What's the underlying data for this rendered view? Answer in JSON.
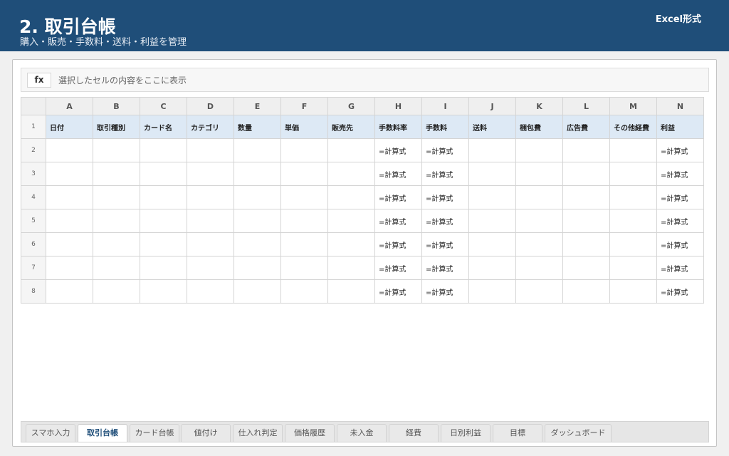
{
  "header": {
    "title": "2. 取引台帳",
    "subtitle": "購入・販売・手数料・送料・利益を管理",
    "format_label": "Excel形式"
  },
  "formula_bar": {
    "fx_label": "fx",
    "text": "選択したセルの内容をここに表示"
  },
  "sheet": {
    "columns": [
      "A",
      "B",
      "C",
      "D",
      "E",
      "F",
      "G",
      "H",
      "I",
      "J",
      "K",
      "L",
      "M",
      "N"
    ],
    "header_row_number": "1",
    "headers": [
      "日付",
      "取引種別",
      "カード名",
      "カテゴリ",
      "数量",
      "単価",
      "販売先",
      "手数料率",
      "手数料",
      "送料",
      "梱包費",
      "広告費",
      "その他経費",
      "利益"
    ],
    "rows": [
      {
        "num": "2",
        "cells": [
          "",
          "",
          "",
          "",
          "",
          "",
          "",
          "=計算式",
          "=計算式",
          "",
          "",
          "",
          "",
          "=計算式"
        ]
      },
      {
        "num": "3",
        "cells": [
          "",
          "",
          "",
          "",
          "",
          "",
          "",
          "=計算式",
          "=計算式",
          "",
          "",
          "",
          "",
          "=計算式"
        ]
      },
      {
        "num": "4",
        "cells": [
          "",
          "",
          "",
          "",
          "",
          "",
          "",
          "=計算式",
          "=計算式",
          "",
          "",
          "",
          "",
          "=計算式"
        ]
      },
      {
        "num": "5",
        "cells": [
          "",
          "",
          "",
          "",
          "",
          "",
          "",
          "=計算式",
          "=計算式",
          "",
          "",
          "",
          "",
          "=計算式"
        ]
      },
      {
        "num": "6",
        "cells": [
          "",
          "",
          "",
          "",
          "",
          "",
          "",
          "=計算式",
          "=計算式",
          "",
          "",
          "",
          "",
          "=計算式"
        ]
      },
      {
        "num": "7",
        "cells": [
          "",
          "",
          "",
          "",
          "",
          "",
          "",
          "=計算式",
          "=計算式",
          "",
          "",
          "",
          "",
          "=計算式"
        ]
      },
      {
        "num": "8",
        "cells": [
          "",
          "",
          "",
          "",
          "",
          "",
          "",
          "=計算式",
          "=計算式",
          "",
          "",
          "",
          "",
          "=計算式"
        ]
      }
    ]
  },
  "tabs": [
    {
      "label": "スマホ入力",
      "active": false
    },
    {
      "label": "取引台帳",
      "active": true
    },
    {
      "label": "カード台帳",
      "active": false
    },
    {
      "label": "値付け",
      "active": false
    },
    {
      "label": "仕入れ判定",
      "active": false
    },
    {
      "label": "価格履歴",
      "active": false
    },
    {
      "label": "未入金",
      "active": false
    },
    {
      "label": "経費",
      "active": false
    },
    {
      "label": "日別利益",
      "active": false
    },
    {
      "label": "目標",
      "active": false
    },
    {
      "label": "ダッシュボード",
      "active": false
    }
  ]
}
